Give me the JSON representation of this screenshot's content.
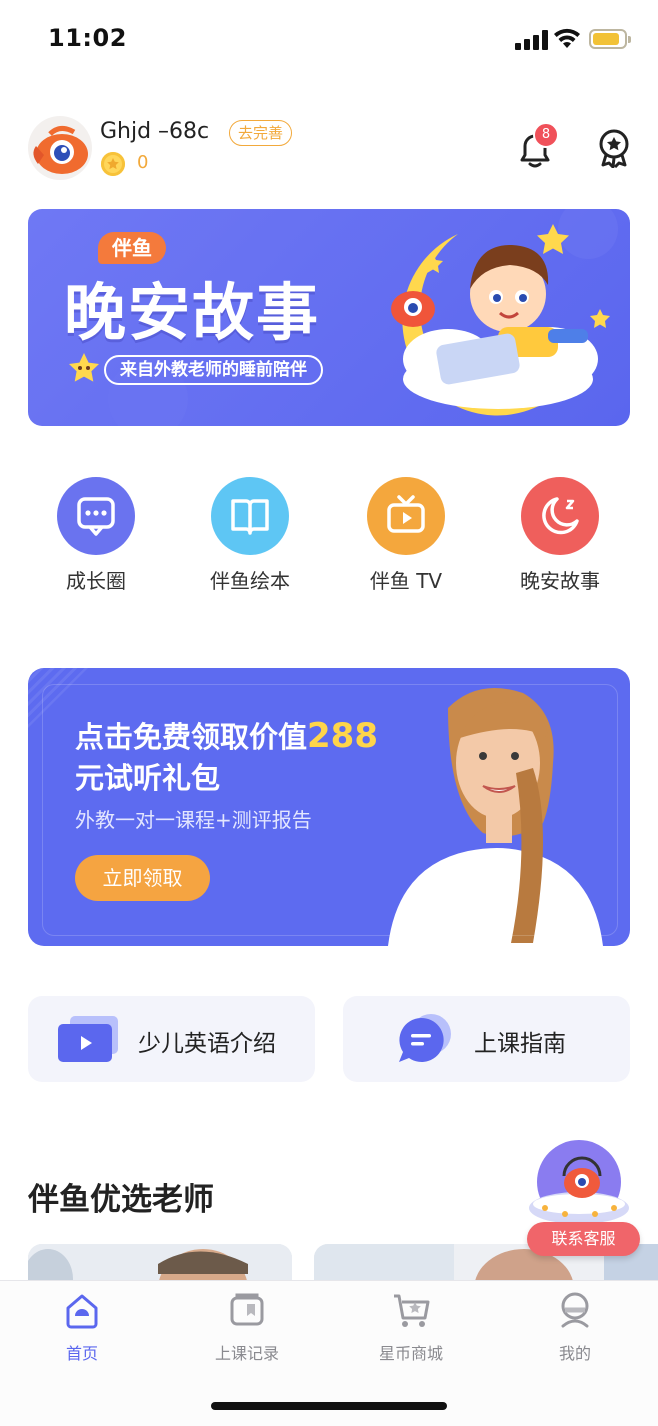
{
  "status_bar": {
    "time": "11:02"
  },
  "profile": {
    "username": "Ghjd –68c",
    "complete_label": "去完善",
    "coins": "0",
    "notification_count": "8"
  },
  "story_banner": {
    "pill": "伴鱼",
    "title": "晚安故事",
    "subtitle": "来自外教老师的睡前陪伴"
  },
  "quick_nav": [
    {
      "label": "成长圈",
      "icon": "chat-bubble-icon",
      "color": "#6a73ef"
    },
    {
      "label": "伴鱼绘本",
      "icon": "book-icon",
      "color": "#5ec6f4"
    },
    {
      "label": "伴鱼 TV",
      "icon": "tv-icon",
      "color": "#f4a73d"
    },
    {
      "label": "晚安故事",
      "icon": "moon-icon",
      "color": "#ef5f5c"
    }
  ],
  "promo": {
    "title_a": "点击免费领取价值",
    "title_highlight": "288",
    "title_b": "元试听礼包",
    "subtitle": "外教一对一课程+测评报告",
    "button": "立即领取"
  },
  "intro_cards": [
    {
      "label": "少儿英语介绍",
      "icon": "video-play-icon"
    },
    {
      "label": "上课指南",
      "icon": "message-icon"
    }
  ],
  "section_title": "伴鱼优选老师",
  "service_label": "联系客服",
  "tabs": [
    {
      "label": "首页",
      "icon": "home-icon",
      "active": true
    },
    {
      "label": "上课记录",
      "icon": "records-icon",
      "active": false
    },
    {
      "label": "星币商城",
      "icon": "cart-icon",
      "active": false
    },
    {
      "label": "我的",
      "icon": "profile-icon",
      "active": false
    }
  ],
  "colors": {
    "primary": "#5b67ee",
    "accent_orange": "#f5a441",
    "highlight_yellow": "#ffd54a",
    "badge_red": "#f0515a"
  }
}
